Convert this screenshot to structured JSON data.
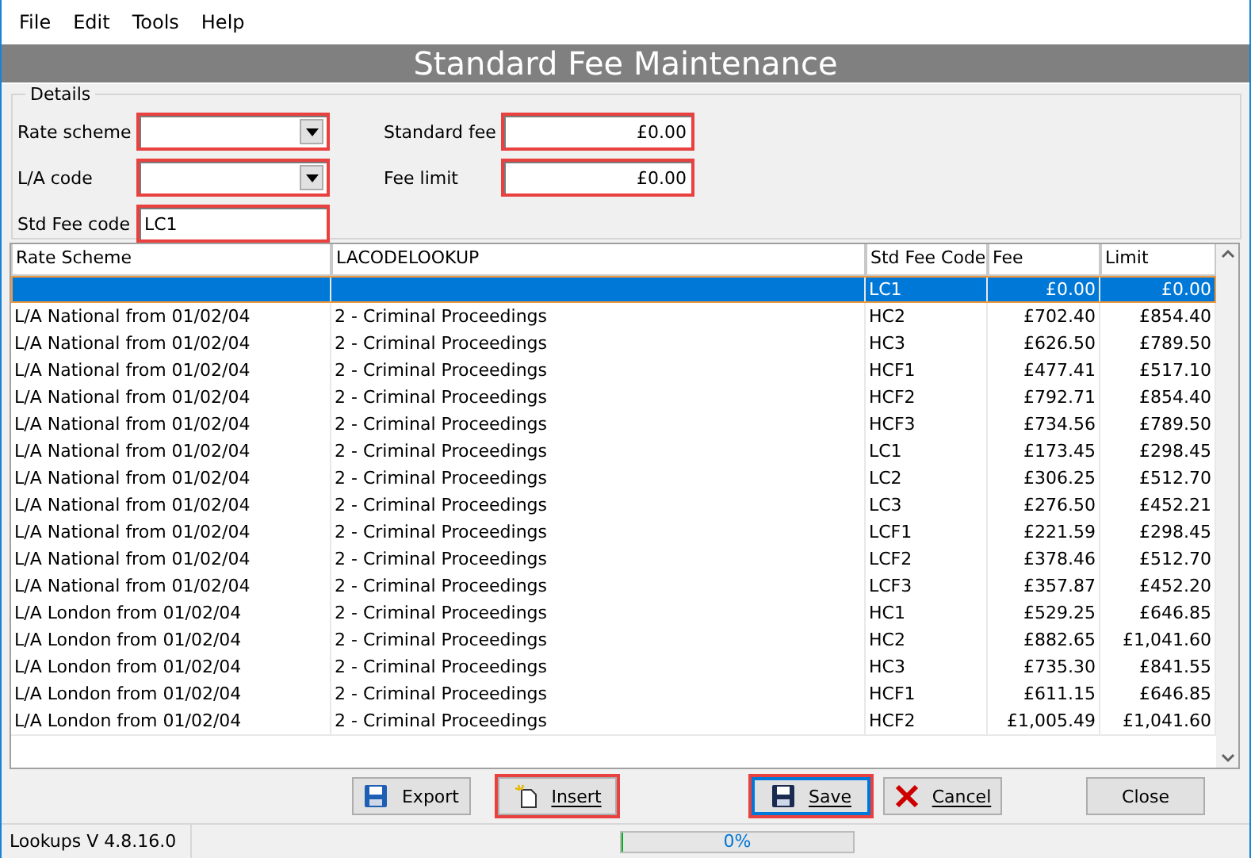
{
  "menu": [
    "File",
    "Edit",
    "Tools",
    "Help"
  ],
  "title": "Standard Fee Maintenance",
  "details": {
    "legend": "Details",
    "left_fields": [
      {
        "label": "Rate scheme",
        "kind": "dropdown",
        "highlighted": true
      },
      {
        "label": "L/A code",
        "kind": "dropdown",
        "highlighted": true
      },
      {
        "label": "Std Fee code",
        "kind": "text",
        "value": "LC1",
        "highlighted": true
      }
    ],
    "right_fields": [
      {
        "label": "Standard fee",
        "kind": "amount",
        "value": "£0.00",
        "highlighted": true
      },
      {
        "label": "Fee limit",
        "kind": "amount",
        "value": "£0.00",
        "highlighted": true
      }
    ]
  },
  "table": {
    "columns": [
      "Rate Scheme",
      "LACODELOOKUP",
      "Std Fee Code",
      "Fee",
      "Limit"
    ],
    "rows": [
      {
        "cells": [
          "",
          "",
          "LC1",
          "£0.00",
          "£0.00"
        ],
        "selected": true
      },
      {
        "cells": [
          "L/A National from 01/02/04",
          "2 - Criminal Proceedings",
          "HC2",
          "£702.40",
          "£854.40"
        ],
        "selected": false
      },
      {
        "cells": [
          "L/A National from 01/02/04",
          "2 - Criminal Proceedings",
          "HC3",
          "£626.50",
          "£789.50"
        ],
        "selected": false
      },
      {
        "cells": [
          "L/A National from 01/02/04",
          "2 - Criminal Proceedings",
          "HCF1",
          "£477.41",
          "£517.10"
        ],
        "selected": false
      },
      {
        "cells": [
          "L/A National from 01/02/04",
          "2 - Criminal Proceedings",
          "HCF2",
          "£792.71",
          "£854.40"
        ],
        "selected": false
      },
      {
        "cells": [
          "L/A National from 01/02/04",
          "2 - Criminal Proceedings",
          "HCF3",
          "£734.56",
          "£789.50"
        ],
        "selected": false
      },
      {
        "cells": [
          "L/A National from 01/02/04",
          "2 - Criminal Proceedings",
          "LC1",
          "£173.45",
          "£298.45"
        ],
        "selected": false
      },
      {
        "cells": [
          "L/A National from 01/02/04",
          "2 - Criminal Proceedings",
          "LC2",
          "£306.25",
          "£512.70"
        ],
        "selected": false
      },
      {
        "cells": [
          "L/A National from 01/02/04",
          "2 - Criminal Proceedings",
          "LC3",
          "£276.50",
          "£452.21"
        ],
        "selected": false
      },
      {
        "cells": [
          "L/A National from 01/02/04",
          "2 - Criminal Proceedings",
          "LCF1",
          "£221.59",
          "£298.45"
        ],
        "selected": false
      },
      {
        "cells": [
          "L/A National from 01/02/04",
          "2 - Criminal Proceedings",
          "LCF2",
          "£378.46",
          "£512.70"
        ],
        "selected": false
      },
      {
        "cells": [
          "L/A National from 01/02/04",
          "2 - Criminal Proceedings",
          "LCF3",
          "£357.87",
          "£452.20"
        ],
        "selected": false
      },
      {
        "cells": [
          "L/A London from 01/02/04",
          "2 - Criminal Proceedings",
          "HC1",
          "£529.25",
          "£646.85"
        ],
        "selected": false
      },
      {
        "cells": [
          "L/A London from 01/02/04",
          "2 - Criminal Proceedings",
          "HC2",
          "£882.65",
          "£1,041.60"
        ],
        "selected": false
      },
      {
        "cells": [
          "L/A London from 01/02/04",
          "2 - Criminal Proceedings",
          "HC3",
          "£735.30",
          "£841.55"
        ],
        "selected": false
      },
      {
        "cells": [
          "L/A London from 01/02/04",
          "2 - Criminal Proceedings",
          "HCF1",
          "£611.15",
          "£646.85"
        ],
        "selected": false
      },
      {
        "cells": [
          "L/A London from 01/02/04",
          "2 - Criminal Proceedings",
          "HCF2",
          "£1,005.49",
          "£1,041.60"
        ],
        "selected": false
      }
    ]
  },
  "buttons": [
    {
      "label": "Export",
      "highlighted": false,
      "focused": false
    },
    {
      "label": "Insert",
      "highlighted": true,
      "focused": false
    },
    {
      "label": "Save",
      "highlighted": true,
      "focused": true
    },
    {
      "label": "Cancel",
      "highlighted": false,
      "focused": false
    },
    {
      "label": "Close",
      "highlighted": false,
      "focused": false
    }
  ],
  "status_bar": {
    "version": "Lookups V 4.8.16.0",
    "progress": {
      "level": 0,
      "reading": "0%"
    }
  }
}
